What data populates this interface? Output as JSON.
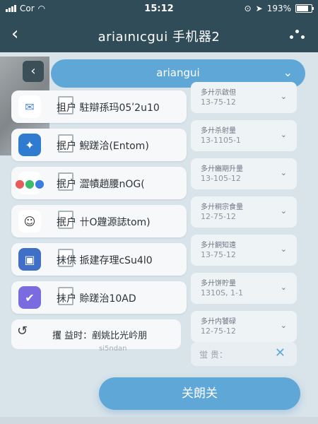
{
  "status_bar": {
    "carrier": "Cor",
    "time": "15:12",
    "battery_text": "193%",
    "battery_level": 0.9
  },
  "nav": {
    "back_glyph": "‹",
    "title": "ariaınıcgui 手机器2"
  },
  "search": {
    "value": "ariangui",
    "back_glyph": "‹"
  },
  "list_items": [
    {
      "label": "抯户 駐辯孫玛05ʹ2u10",
      "icon": "envelope-icon",
      "color": "#4b8ad8",
      "glyph": "✉"
    },
    {
      "label": "抿户 鯢蹉洽(Entom)",
      "icon": "app-icon",
      "color": "#2f7bd0",
      "glyph": "✦"
    },
    {
      "label": "抿户 澀幘趙腰nOG(",
      "icon": "dots-grid-icon",
      "color": "#ffffff",
      "glyph": "⁘"
    },
    {
      "label": "抿户 卄O韙源誌tom)",
      "icon": "avatar-icon",
      "color": "#ffffff",
      "glyph": "☺"
    },
    {
      "label": "抺供 挀建存理cSu4l0",
      "icon": "photo-icon",
      "color": "#3f6fc6",
      "glyph": "▣"
    },
    {
      "label": "抺户 賒蹉治10AD",
      "icon": "shield-check-icon",
      "color": "#7a6be0",
      "glyph": "✔"
    }
  ],
  "right_cards": [
    {
      "title": "多廾示啟但",
      "subtitle": "13-75-12"
    },
    {
      "title": "多廾杀射量",
      "subtitle": "13-1105-1"
    },
    {
      "title": "多廾豳期升量",
      "subtitle": "13-105-12"
    },
    {
      "title": "多廾秱宗食量",
      "subtitle": "12-75-12"
    },
    {
      "title": "多廾餇知遠",
      "subtitle": "13-75-12"
    },
    {
      "title": "多廾饼貯量",
      "subtitle": "1310S, 1-1"
    },
    {
      "title": "多廾内饕碌",
      "subtitle": "12-75-12"
    }
  ],
  "time_row": {
    "label": "攫 益时：剷姚比光岒朋",
    "faint": "si5ndan"
  },
  "filter": {
    "text": "蛍 贵：",
    "x_glyph": "✕"
  },
  "close_button": {
    "label": "关朗关"
  }
}
